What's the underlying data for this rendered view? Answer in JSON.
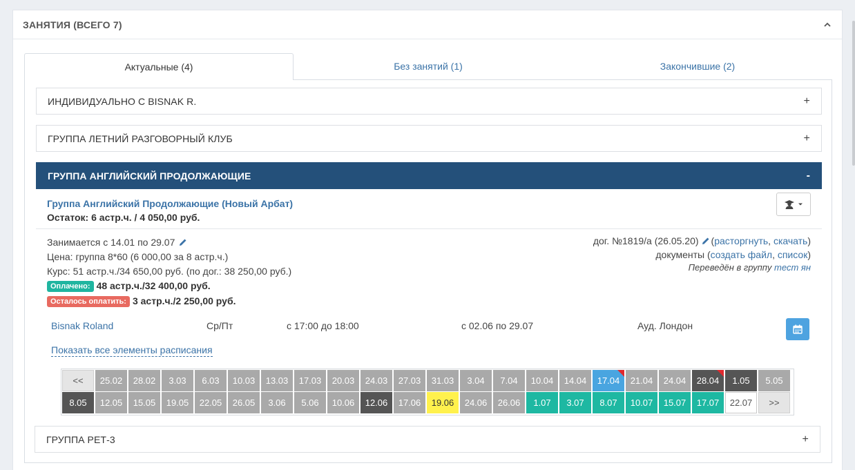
{
  "panel": {
    "title": "ЗАНЯТИЯ (ВСЕГО 7)"
  },
  "tabs": [
    {
      "label": "Актуальные (4)",
      "active": true
    },
    {
      "label": "Без занятий (1)",
      "active": false
    },
    {
      "label": "Закончившие (2)",
      "active": false
    }
  ],
  "accordion": {
    "items": [
      {
        "title": "ИНДИВИДУАЛЬНО С BISNAK R.",
        "sign": "+"
      },
      {
        "title": "ГРУППА ЛЕТНИЙ РАЗГОВОРНЫЙ КЛУБ",
        "sign": "+"
      },
      {
        "title": "ГРУППА АНГЛИЙСКИЙ ПРОДОЛЖАЮЩИЕ",
        "sign": "-"
      },
      {
        "title": "ГРУППА РЕТ-3",
        "sign": "+"
      }
    ]
  },
  "group": {
    "title": "Группа Английский Продолжающие (Новый Арбат)",
    "remaining": "Остаток: 6 астр.ч. / 4 050,00 руб.",
    "studies": "Занимается с 14.01 по 29.07",
    "price": "Цена: группа 8*60 (6 000,00 за 8 астр.ч.)",
    "course": "Курс: 51 астр.ч./34 650,00 руб. (по дог.: 38 250,00 руб.)",
    "paid_badge": "Оплачено:",
    "paid_value": "48 астр.ч./32 400,00 руб.",
    "due_badge": "Осталось оплатить:",
    "due_value": "3 астр.ч./2 250,00 руб.",
    "contract_text": "дог. №1819/а (26.05.20)",
    "contract_open": "(",
    "contract_terminate": "расторгнуть",
    "contract_sep": ", ",
    "contract_download": "скачать",
    "contract_close": ")",
    "docs_text": "документы (",
    "docs_create": "создать файл",
    "docs_sep": ", ",
    "docs_list": "список",
    "docs_close": ")",
    "transferred_text": "Переведён в группу",
    "transferred_link": "тест ян",
    "schedule": {
      "teacher": "Bisnak Roland",
      "days": "Ср/Пт",
      "time": "с 17:00 до 18:00",
      "period": "с 02.06 по 29.07",
      "room": "Ауд. Лондон"
    },
    "show_all": "Показать все элементы расписания"
  },
  "calendar": {
    "prev_label": "<<",
    "next_label": ">>",
    "colors": {
      "gray": "#a9a9a9",
      "dark": "#555555",
      "blue": "#49a5e0",
      "teal": "#1eb8a2",
      "yellow": "#fff14d",
      "white": "#ffffff"
    },
    "row1": [
      {
        "d": "25.02",
        "s": "gray"
      },
      {
        "d": "28.02",
        "s": "gray"
      },
      {
        "d": "3.03",
        "s": "gray"
      },
      {
        "d": "6.03",
        "s": "gray"
      },
      {
        "d": "10.03",
        "s": "gray"
      },
      {
        "d": "13.03",
        "s": "gray"
      },
      {
        "d": "17.03",
        "s": "gray"
      },
      {
        "d": "20.03",
        "s": "gray"
      },
      {
        "d": "24.03",
        "s": "gray"
      },
      {
        "d": "27.03",
        "s": "gray"
      },
      {
        "d": "31.03",
        "s": "gray"
      },
      {
        "d": "3.04",
        "s": "gray"
      },
      {
        "d": "7.04",
        "s": "gray"
      },
      {
        "d": "10.04",
        "s": "gray"
      },
      {
        "d": "14.04",
        "s": "gray"
      },
      {
        "d": "17.04",
        "s": "blue",
        "flag": true
      },
      {
        "d": "21.04",
        "s": "gray"
      },
      {
        "d": "24.04",
        "s": "gray"
      },
      {
        "d": "28.04",
        "s": "dark",
        "flag": true
      },
      {
        "d": "1.05",
        "s": "dark"
      },
      {
        "d": "5.05",
        "s": "gray"
      }
    ],
    "row2": [
      {
        "d": "8.05",
        "s": "dark"
      },
      {
        "d": "12.05",
        "s": "gray"
      },
      {
        "d": "15.05",
        "s": "gray"
      },
      {
        "d": "19.05",
        "s": "gray"
      },
      {
        "d": "22.05",
        "s": "gray"
      },
      {
        "d": "26.05",
        "s": "gray"
      },
      {
        "d": "3.06",
        "s": "gray"
      },
      {
        "d": "5.06",
        "s": "gray"
      },
      {
        "d": "10.06",
        "s": "gray"
      },
      {
        "d": "12.06",
        "s": "dark"
      },
      {
        "d": "17.06",
        "s": "gray"
      },
      {
        "d": "19.06",
        "s": "yellow"
      },
      {
        "d": "24.06",
        "s": "gray"
      },
      {
        "d": "26.06",
        "s": "gray"
      },
      {
        "d": "1.07",
        "s": "teal"
      },
      {
        "d": "3.07",
        "s": "teal"
      },
      {
        "d": "8.07",
        "s": "teal"
      },
      {
        "d": "10.07",
        "s": "teal"
      },
      {
        "d": "15.07",
        "s": "teal"
      },
      {
        "d": "17.07",
        "s": "teal"
      },
      {
        "d": "22.07",
        "s": "white"
      }
    ]
  }
}
